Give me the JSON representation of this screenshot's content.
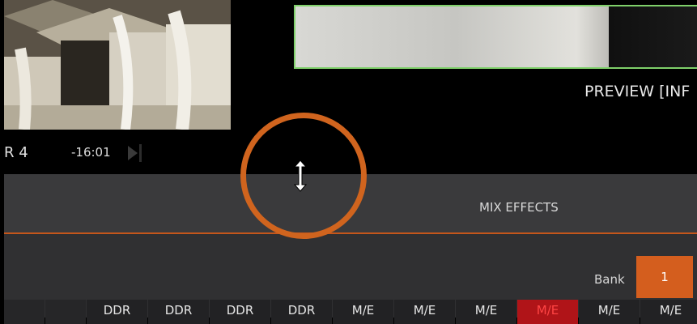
{
  "monitors": {
    "ddr": {
      "number_label": "R 4",
      "time": "-16:01"
    },
    "preview": {
      "label": "PREVIEW [INF"
    }
  },
  "mix_effects": {
    "title": "MIX EFFECTS",
    "bank_label": "Bank",
    "bank_value": "1",
    "accent_color": "#d45e1e"
  },
  "sources": [
    {
      "label": ""
    },
    {
      "label": ""
    },
    {
      "label": "DDR"
    },
    {
      "label": "DDR"
    },
    {
      "label": "DDR"
    },
    {
      "label": "DDR"
    },
    {
      "label": "M/E"
    },
    {
      "label": "M/E"
    },
    {
      "label": "M/E"
    },
    {
      "label": "M/E",
      "active": true
    },
    {
      "label": "M/E"
    },
    {
      "label": "M/E"
    }
  ]
}
